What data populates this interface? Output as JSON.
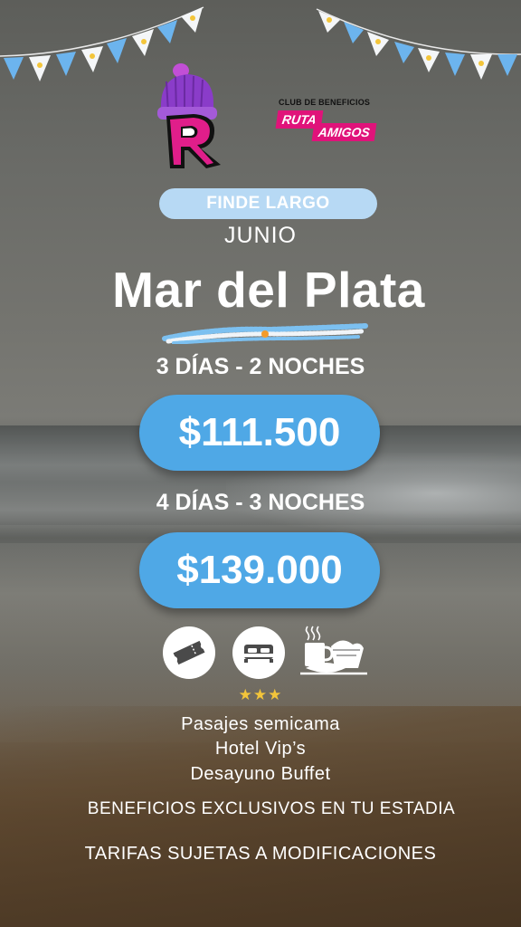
{
  "brand": {
    "logo_letter": "R",
    "club_title": "CLUB DE BENEFICIOS",
    "club_ruta": "RUTA",
    "club_amigos": "AMIGOS"
  },
  "promo": {
    "tag": "FINDE LARGO",
    "month": "JUNIO",
    "destination": "Mar del Plata"
  },
  "packages": [
    {
      "duration": "3 DÍAS - 2 NOCHES",
      "price": "$111.500"
    },
    {
      "duration": "4 DÍAS - 3 NOCHES",
      "price": "$139.000"
    }
  ],
  "amenities": {
    "icons": [
      "ticket-icon",
      "bed-icon",
      "breakfast-icon"
    ],
    "stars": "★★★",
    "items": [
      "Pasajes semicama",
      "Hotel Vip’s",
      "Desayuno Buffet"
    ]
  },
  "footer": {
    "benefits": "BENEFICIOS EXCLUSIVOS EN TU ESTADIA",
    "disclaimer": "TARIFAS SUJETAS A MODIFICACIONES"
  },
  "colors": {
    "accent_blue": "#4fa8e6",
    "pill_light_blue": "#b7d9f4",
    "brand_pink": "#e0137a",
    "brand_purple": "#7a2fb8",
    "star_gold": "#f3c53a"
  }
}
